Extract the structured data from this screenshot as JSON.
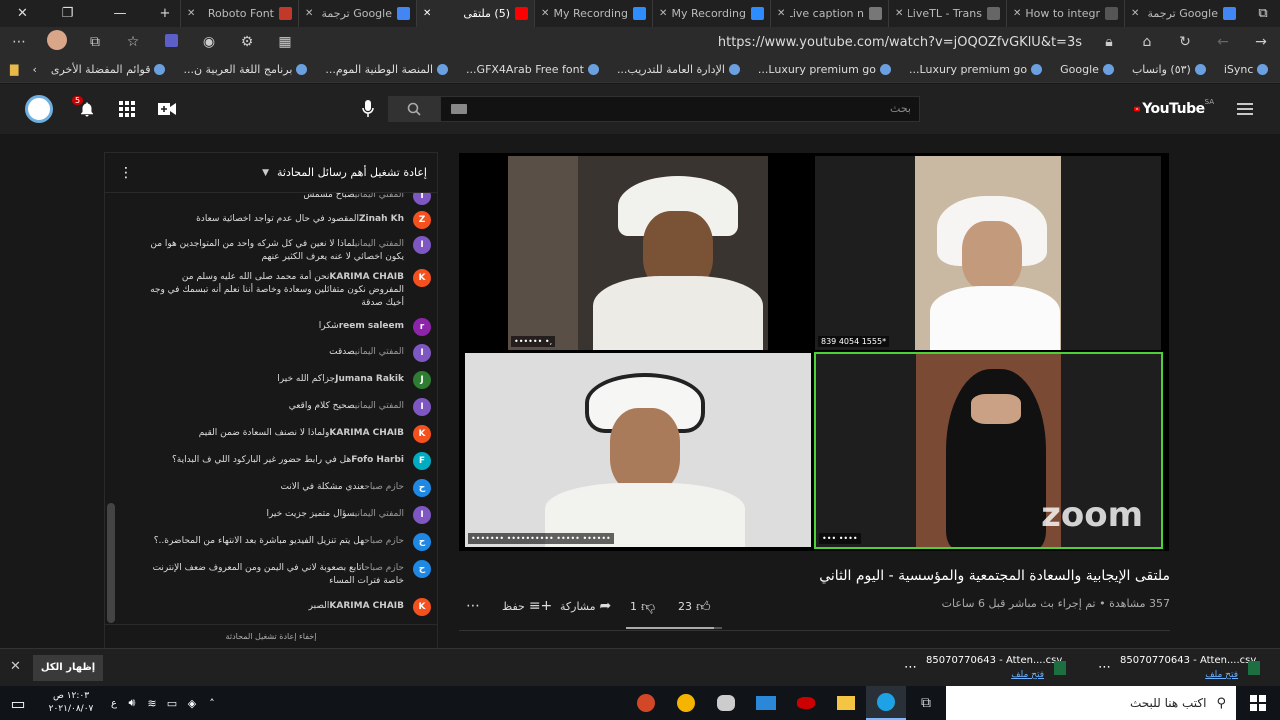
{
  "browser": {
    "tabs": [
      {
        "label": "Google ترجمة",
        "fav": "#4285f4"
      },
      {
        "label": "How to integr",
        "fav": "#555"
      },
      {
        "label": "LiveTL - Trans",
        "fav": "#666"
      },
      {
        "label": "Live caption n",
        "fav": "#777"
      },
      {
        "label": "My Recording",
        "fav": "#2d8cff"
      },
      {
        "label": "My Recording",
        "fav": "#2d8cff"
      },
      {
        "label": "(5) ملتقى",
        "fav": "#f00",
        "active": true
      },
      {
        "label": "Google ترجمة",
        "fav": "#4285f4"
      },
      {
        "label": "Roboto Font",
        "fav": "#c0392b"
      }
    ],
    "url": "https://www.youtube.com/watch?v=jOQOZfvGKlU&t=3s",
    "bookmarks": [
      "Free Vectors, Stock...",
      "iSync",
      "(٥٣) واتساب",
      "Google",
      "Luxury premium go...",
      "Luxury premium go...",
      "الإدارة العامة للتدريب...",
      "GFX4Arab Free font...",
      "المنصة الوطنية الموم...",
      "برنامج اللغة العربية ن...",
      "قوائم المفضلة الأخرى"
    ]
  },
  "youtube": {
    "brand": "YouTube",
    "region": "SA",
    "search_placeholder": "بحث",
    "notif_count": "5"
  },
  "chat": {
    "header": "إعادة تشغيل أهم رسائل المحادثة",
    "footer": "إخفاء إعادة تشغيل المحادثة",
    "messages": [
      {
        "name": "المفتي اليماني",
        "text": "صباح مشمش",
        "color": "#7e57c2",
        "letter": "I",
        "top": 0
      },
      {
        "name": "Zinah Kh",
        "text": "المقصود في حال عدم تواجد اخصائية سعادة",
        "color": "#f4511e",
        "letter": "Z",
        "top": 0
      },
      {
        "name": "المفتي اليماني",
        "text": "لماذا لا نعين في كل شركه واحد من المتواجدين هوا من يكون اخصائي لا عنه يعرف الكثير عنهم",
        "color": "#7e57c2",
        "letter": "I",
        "top": 0
      },
      {
        "name": "KARIMA CHAIB",
        "text": "نحن أمة محمد صلى الله عليه وسلم من المفروض نكون متفائلين وسعادة وخاصة أننا نعلم أنه تبسمك في وجه أخيك صدقة",
        "color": "#f4511e",
        "letter": "K",
        "top": 0
      },
      {
        "name": "reem saleem",
        "text": "شكرا",
        "color": "#8e24aa",
        "letter": "r",
        "top": 0
      },
      {
        "name": "المفتي اليماني",
        "text": "صدقت",
        "color": "#7e57c2",
        "letter": "I",
        "top": 0
      },
      {
        "name": "Jumana Rakik",
        "text": "جزاكم الله خيرا",
        "color": "#2e7d32",
        "letter": "J",
        "top": 0
      },
      {
        "name": "المفتي اليماني",
        "text": "صحيح كلام واقعي",
        "color": "#7e57c2",
        "letter": "I",
        "top": 0
      },
      {
        "name": "KARIMA CHAIB",
        "text": "ولماذا لا نصنف السعادة ضمن القيم",
        "color": "#f4511e",
        "letter": "K",
        "top": 0
      },
      {
        "name": "Fofo Harbi",
        "text": "هل في رابط حضور غير الباركود اللي ف البداية؟",
        "color": "#00acc1",
        "letter": "F",
        "top": 0
      },
      {
        "name": "حازم صباح",
        "text": "عندي مشكلة في الانت",
        "color": "#1e88e5",
        "letter": "ح",
        "top": 0
      },
      {
        "name": "المفتي اليماني",
        "text": "سؤال متميز جزيت خيرا",
        "color": "#7e57c2",
        "letter": "I",
        "top": 0
      },
      {
        "name": "حازم صباح",
        "text": "هل يتم تنزيل الفيديو مباشرة بعد الانتهاء من المحاضرة..؟",
        "color": "#1e88e5",
        "letter": "ح",
        "top": 0
      },
      {
        "name": "حازم صباح",
        "text": "اتابع بصعوبة لاني في اليمن ومن المعروف ضعف الإنترنت خاصة فترات المساء",
        "color": "#1e88e5",
        "letter": "ح",
        "top": 0
      },
      {
        "name": "KARIMA CHAIB",
        "text": "الصبر",
        "color": "#f4511e",
        "letter": "K",
        "top": 0
      }
    ]
  },
  "video": {
    "title": "ملتقى الإيجابية والسعادة المجتمعية والمؤسسية - اليوم الثاني",
    "meta": "357 مشاهدة • تم إجراء بث مباشر قبل 6 ساعات",
    "likes": "23",
    "dislikes": "1",
    "share": "مشاركة",
    "save": "حفظ",
    "zoom": "zoom",
    "phone_label": "839 4054 1555*"
  },
  "downloads": {
    "show_all": "إظهار الكل",
    "items": [
      {
        "name": "85070770643 - Atten....csv",
        "action": "فتح ملف"
      },
      {
        "name": "85070770643 - Atten....csv",
        "action": "فتح ملف"
      }
    ]
  },
  "taskbar": {
    "search": "اكتب هنا للبحث",
    "time": "١٢:٠٣ ص",
    "date": "٢٠٢١/٠٨/٠٧",
    "lang": "ع"
  }
}
